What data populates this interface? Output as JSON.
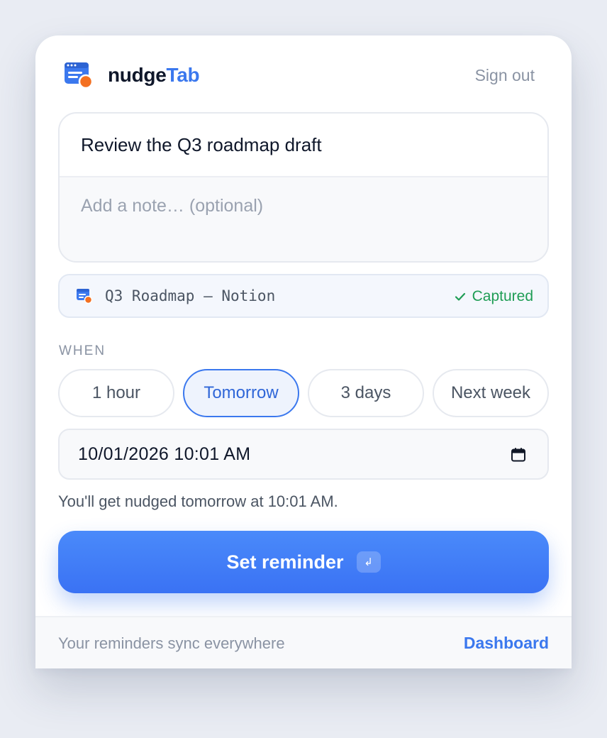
{
  "header": {
    "brand_primary": "nudge",
    "brand_accent": "Tab",
    "sign_out_label": "Sign out",
    "logo_icon": "browser-window-icon"
  },
  "compose": {
    "title_value": "Review the Q3 roadmap draft",
    "note_placeholder": "Add a note… (optional)"
  },
  "source": {
    "icon": "browser-window-icon",
    "page_title": "Q3 Roadmap — Notion",
    "status_label": "Captured",
    "status_icon": "check-icon"
  },
  "when": {
    "label": "WHEN",
    "options": [
      {
        "label": "1 hour",
        "selected": false
      },
      {
        "label": "Tomorrow",
        "selected": true
      },
      {
        "label": "3 days",
        "selected": false
      },
      {
        "label": "Next week",
        "selected": false
      }
    ],
    "datetime_value": "10/01/2026 10:01 AM",
    "calendar_icon": "calendar-icon"
  },
  "hint_text": "You'll get nudged tomorrow at 10:01 AM.",
  "submit": {
    "label": "Set reminder",
    "shortcut_glyph": "↲"
  },
  "footer": {
    "text": "Your reminders sync everywhere",
    "link_label": "Dashboard"
  },
  "colors": {
    "accent": "#3b78ee",
    "badge_orange": "#f37021",
    "success": "#1f9d55",
    "text_primary": "#0f172a",
    "text_muted": "#8a93a3"
  }
}
